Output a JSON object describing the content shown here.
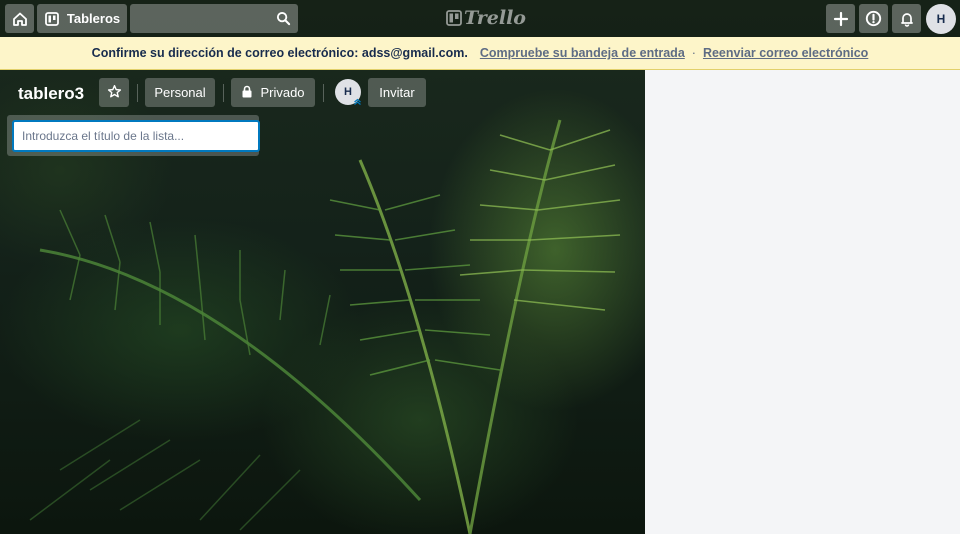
{
  "header": {
    "home_icon": "home-icon",
    "boards_icon": "board-icon",
    "boards_label": "Tableros",
    "search_icon": "search-icon",
    "logo_text": "Trello",
    "add_icon": "plus-icon",
    "info_icon": "info-icon",
    "bell_icon": "bell-icon",
    "avatar_initial": "H"
  },
  "banner": {
    "message": "Confirme su dirección de correo electrónico: adss@gmail.com.",
    "check_inbox": "Compruebe su bandeja de entrada",
    "separator": "·",
    "resend": "Reenviar correo electrónico",
    "background_color": "#fdf5c9"
  },
  "board": {
    "title": "tablero3",
    "workspace_label": "Personal",
    "visibility_label": "Privado",
    "member_initial": "H",
    "invite_label": "Invitar"
  },
  "add_list": {
    "placeholder": "Introduzca el título de la lista..."
  },
  "colors": {
    "accent": "#0079bf",
    "right_pane": "#f4f5f7"
  }
}
